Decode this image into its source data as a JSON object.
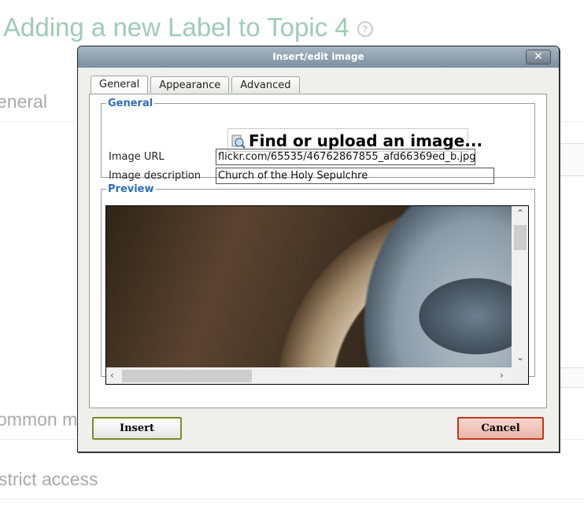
{
  "page": {
    "title": "Adding a new Label to Topic 4",
    "help_icon": "question-circle-icon",
    "sections": [
      "eneral",
      "ommon m",
      "strict access"
    ]
  },
  "dialog": {
    "title": "Insert/edit image",
    "close_label": "✕",
    "tabs": [
      {
        "label": "General",
        "active": true
      },
      {
        "label": "Appearance"
      },
      {
        "label": "Advanced"
      }
    ],
    "general": {
      "legend": "General",
      "find_button": "Find or upload an image...",
      "url_label": "Image URL",
      "url_value": "flickr.com/65535/46762867855_afd66369ed_b.jpg",
      "desc_label": "Image description",
      "desc_value": "Church of the Holy Sepulchre"
    },
    "preview": {
      "legend": "Preview"
    },
    "insert_label": "Insert",
    "cancel_label": "Cancel"
  }
}
